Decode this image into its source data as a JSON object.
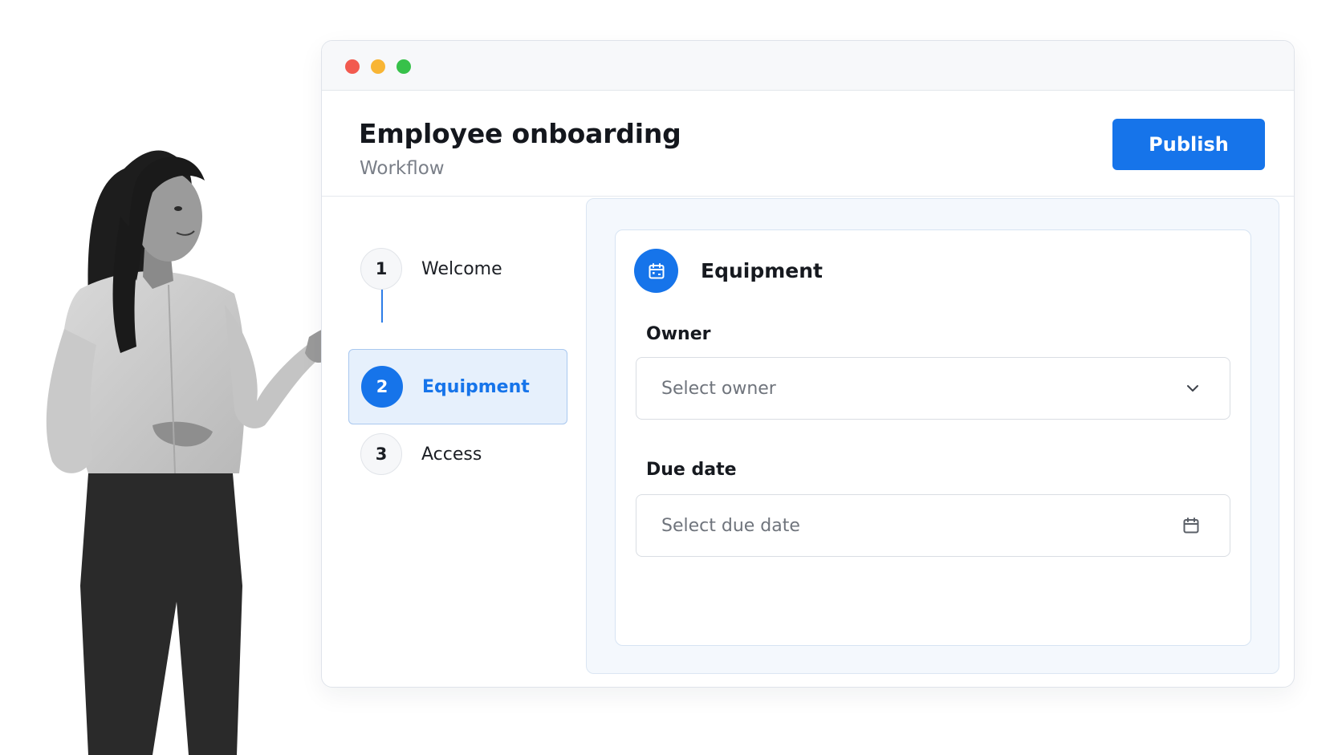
{
  "window": {
    "title": "Employee onboarding",
    "subtitle": "Workflow",
    "publish_label": "Publish"
  },
  "steps": [
    {
      "number": "1",
      "label": "Welcome",
      "active": false
    },
    {
      "number": "2",
      "label": "Equipment",
      "active": true
    },
    {
      "number": "3",
      "label": "Access",
      "active": false
    }
  ],
  "card": {
    "title": "Equipment",
    "icon": "calendar-icon",
    "owner_label": "Owner",
    "owner_placeholder": "Select owner",
    "due_date_label": "Due date",
    "due_date_placeholder": "Select due date"
  },
  "colors": {
    "accent": "#1674ea",
    "active_step_bg": "#e6f0fc",
    "traffic_red": "#f25a4f",
    "traffic_yellow": "#f8b535",
    "traffic_green": "#37c14a"
  }
}
